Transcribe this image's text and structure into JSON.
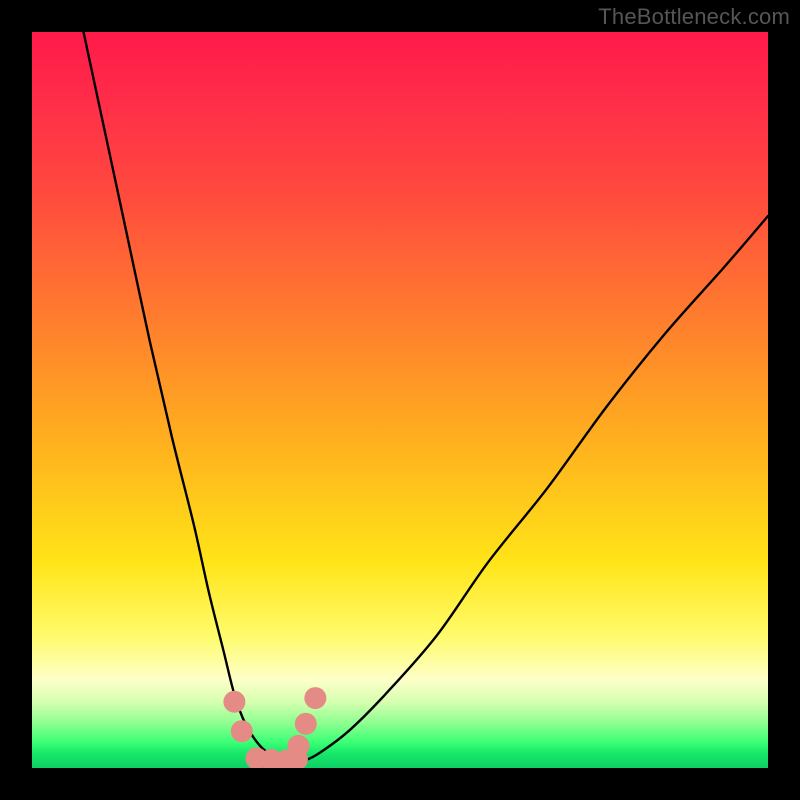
{
  "watermark": "TheBottleneck.com",
  "chart_data": {
    "type": "line",
    "title": "",
    "xlabel": "",
    "ylabel": "",
    "xlim": [
      0,
      100
    ],
    "ylim": [
      0,
      100
    ],
    "note": "Axes/ticks not shown in image; x and y are normalized 0–100 estimates read from pixel positions.",
    "series": [
      {
        "name": "curve",
        "x": [
          7,
          10,
          13,
          16,
          19,
          22,
          24,
          26,
          27.5,
          29,
          31,
          33,
          35,
          36,
          37,
          39,
          43,
          48,
          55,
          62,
          70,
          78,
          86,
          94,
          100
        ],
        "y": [
          100,
          86,
          72,
          58,
          45,
          33,
          24,
          16,
          10,
          6,
          3,
          1.5,
          1,
          1,
          1,
          2,
          5,
          10,
          18,
          28,
          38,
          49,
          59,
          68,
          75
        ]
      }
    ],
    "markers": [
      {
        "name": "left-cluster-top",
        "x": 27.5,
        "y": 9.0
      },
      {
        "name": "left-cluster-bottom",
        "x": 28.5,
        "y": 5.0
      },
      {
        "name": "right-cluster-top",
        "x": 38.5,
        "y": 9.5
      },
      {
        "name": "right-cluster-mid",
        "x": 37.2,
        "y": 6.0
      },
      {
        "name": "right-cluster-low",
        "x": 36.2,
        "y": 3.0
      },
      {
        "name": "trough-1",
        "x": 30.5,
        "y": 1.3
      },
      {
        "name": "trough-2",
        "x": 32.5,
        "y": 1.1
      },
      {
        "name": "trough-3",
        "x": 34.5,
        "y": 1.0
      },
      {
        "name": "trough-4",
        "x": 36.0,
        "y": 1.2
      }
    ],
    "marker_style": {
      "color": "#e58b86",
      "radius_px": 11
    },
    "background_gradient": {
      "direction": "top-to-bottom",
      "stops": [
        {
          "pos": 0.0,
          "color": "#ff1a4a"
        },
        {
          "pos": 0.3,
          "color": "#ff6a33"
        },
        {
          "pos": 0.6,
          "color": "#ffd61a"
        },
        {
          "pos": 0.85,
          "color": "#fdffa6"
        },
        {
          "pos": 1.0,
          "color": "#11d566"
        }
      ]
    }
  }
}
